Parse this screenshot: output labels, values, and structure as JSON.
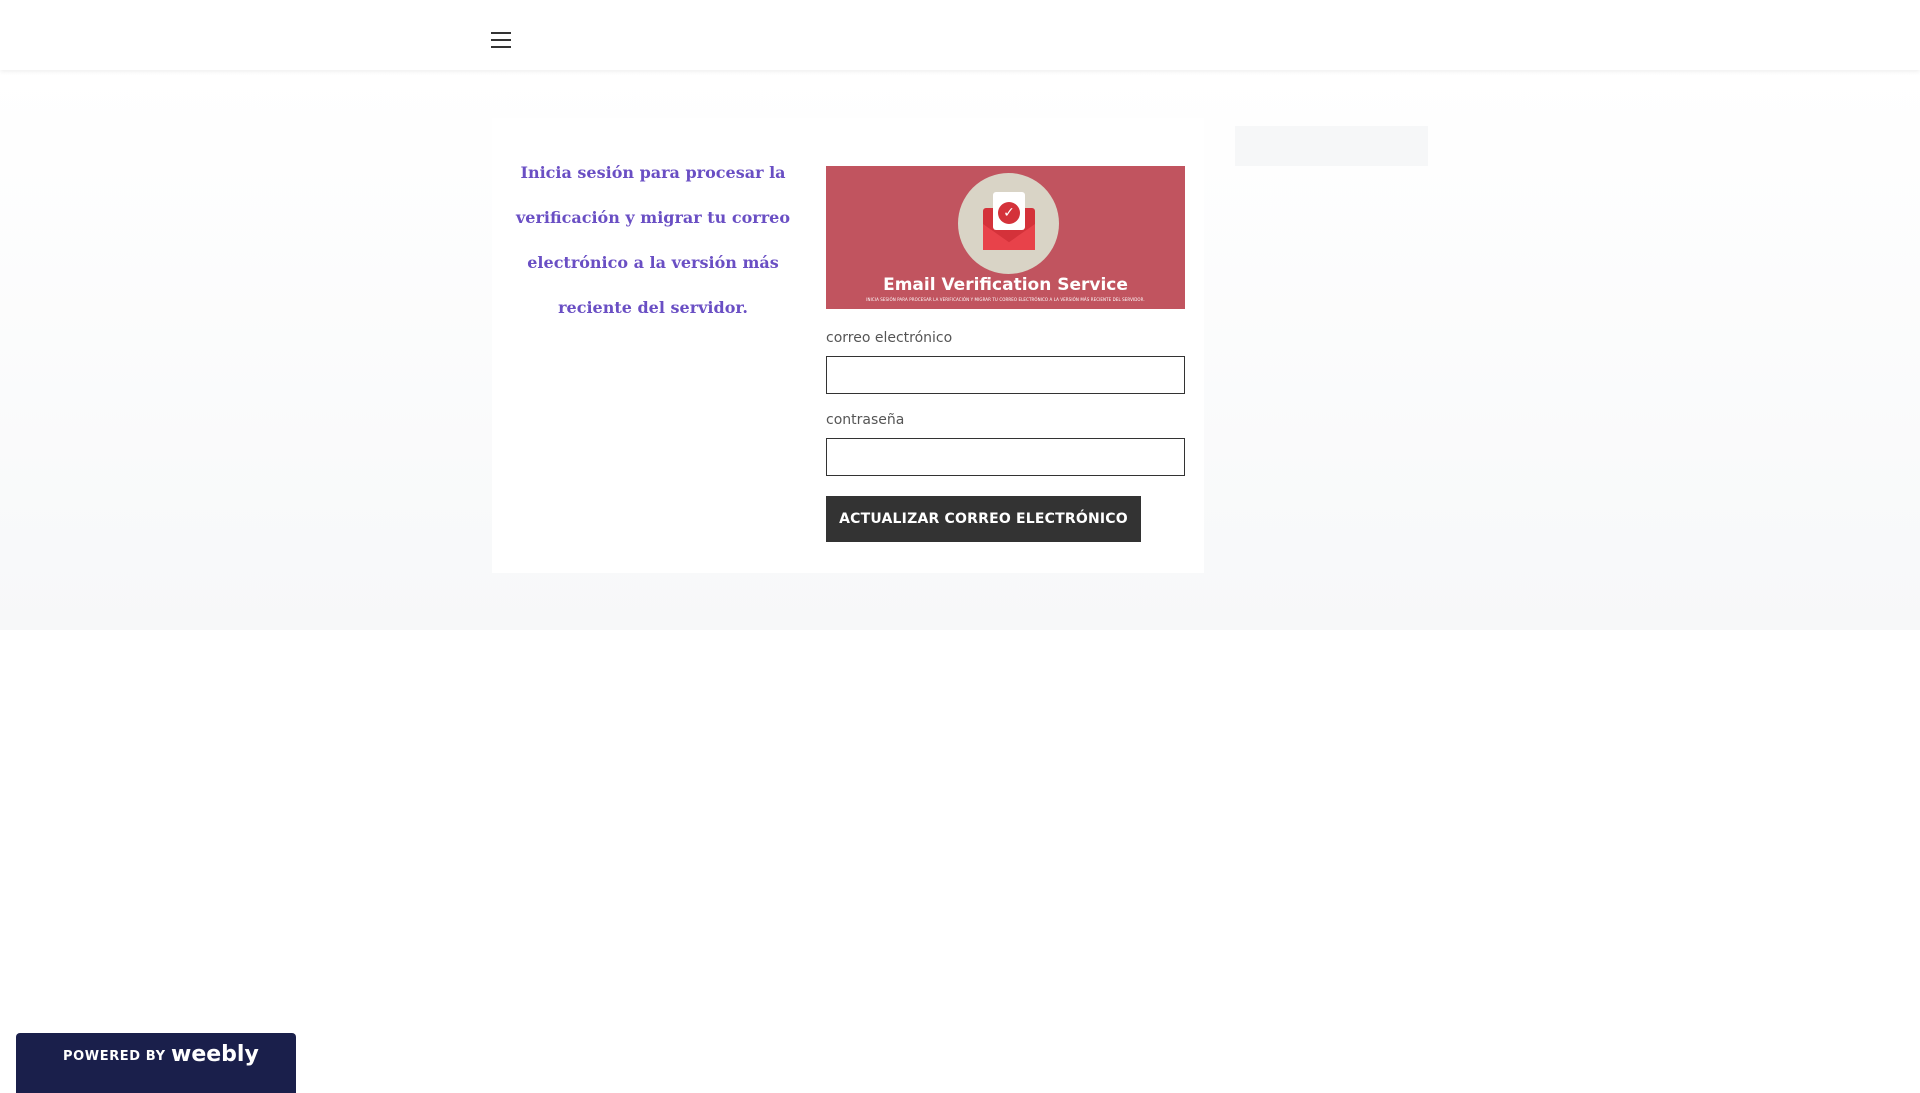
{
  "header": {
    "menu_icon": "hamburger-menu-icon"
  },
  "intro": {
    "text": "Inicia sesión para procesar la verificación y migrar tu correo electrónico a la versión más reciente del servidor."
  },
  "banner": {
    "title": "Email Verification Service",
    "subtitle": "INICIA SESIÓN PARA PROCESAR LA VERIFICACIÓN Y MIGRAR TU CORREO ELECTRÓNICO A LA VERSIÓN MÁS RECIENTE DEL SERVIDOR.",
    "icon": "envelope-check-icon",
    "colors": {
      "background": "#c1545f",
      "circle": "#d9d4c6",
      "envelope": "#d4323a"
    }
  },
  "form": {
    "email_label": "correo electrónico",
    "email_value": "",
    "password_label": "contraseña",
    "password_value": "",
    "submit_label": "ACTUALIZAR CORREO ELECTRÓNICO"
  },
  "footer": {
    "powered_by": "POWERED BY",
    "brand": "weebly"
  },
  "colors": {
    "intro_text": "#6a4fc4",
    "button": "#333333",
    "footer_badge": "#1a1f4b"
  }
}
